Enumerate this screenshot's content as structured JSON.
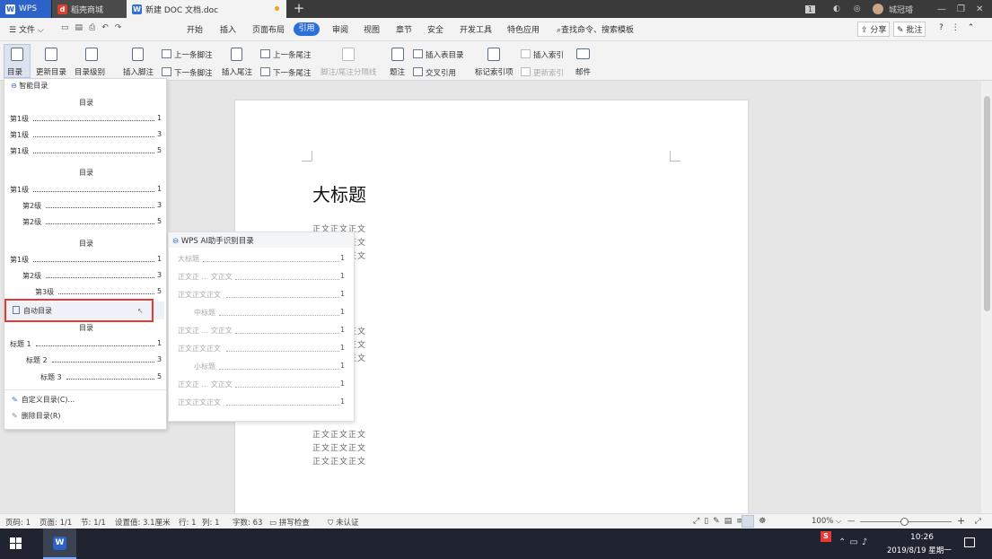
{
  "tabs": {
    "wps": "WPS",
    "daoke": "稻壳商城",
    "doc": "新建 DOC 文档.doc",
    "new_tab": "+"
  },
  "titlebar": {
    "badge": "1",
    "user": "城冠璿"
  },
  "menu": {
    "file": "文件",
    "items": [
      "开始",
      "插入",
      "页面布局",
      "引用",
      "审阅",
      "视图",
      "章节",
      "安全",
      "开发工具",
      "特色应用"
    ],
    "active": "引用",
    "search": "查找命令、搜索模板",
    "share": "分享",
    "annotate": "批注"
  },
  "ribbon": {
    "toc": "目录",
    "update_toc": "更新目录",
    "toc_level": "目录级别",
    "insert_footnote": "插入脚注",
    "prev_footnote": "上一条脚注",
    "next_footnote": "下一条脚注",
    "insert_endnote": "插入尾注",
    "prev_endnote": "上一条尾注",
    "next_endnote": "下一条尾注",
    "separator": "脚注/尾注分隔线",
    "caption": "题注",
    "insert_table_toc": "插入表目录",
    "cross_ref": "交叉引用",
    "mark_index": "标记索引项",
    "insert_index": "插入索引",
    "update_index": "更新索引",
    "mail": "邮件"
  },
  "dropdown": {
    "smart_toc": "智能目录",
    "toc_title": "目录",
    "style1": [
      {
        "label": "第1级",
        "page": "1"
      },
      {
        "label": "第1级",
        "page": "3"
      },
      {
        "label": "第1级",
        "page": "5"
      }
    ],
    "style2": [
      {
        "label": "第1级",
        "page": "1"
      },
      {
        "label": "第2级",
        "page": "3"
      },
      {
        "label": "第2级",
        "page": "5"
      }
    ],
    "style3": [
      {
        "label": "第1级",
        "page": "1"
      },
      {
        "label": "第2级",
        "page": "3"
      },
      {
        "label": "第3级",
        "page": "5"
      }
    ],
    "auto_toc": "自动目录",
    "auto_items": [
      {
        "label": "标题 1",
        "page": "1"
      },
      {
        "label": "标题 2",
        "page": "3"
      },
      {
        "label": "标题 3",
        "page": "5"
      }
    ],
    "custom_toc": "自定义目录(C)...",
    "delete_toc": "删除目录(R)"
  },
  "ai_submenu": {
    "title": "WPS AI助手识别目录",
    "items": [
      {
        "label": "大标题",
        "page": "1"
      },
      {
        "label": "正文正 ... 文正文",
        "page": "1"
      },
      {
        "label": "正文正文正文",
        "page": "1"
      },
      {
        "label": "中标题",
        "page": "1"
      },
      {
        "label": "正文正 ... 文正文",
        "page": "1"
      },
      {
        "label": "正文正文正文",
        "page": "1"
      },
      {
        "label": "小标题",
        "page": "1"
      },
      {
        "label": "正文正 ... 文正文",
        "page": "1"
      },
      {
        "label": "正文正文正文",
        "page": "1"
      }
    ]
  },
  "document": {
    "title": "大标题",
    "body_line": "正文正文正文"
  },
  "status": {
    "page_num": "页码: 1",
    "pages": "页面: 1/1",
    "section": "节: 1/1",
    "setting": "设置值: 3.1厘米",
    "row": "行: 1",
    "col": "列: 1",
    "words": "字数: 63",
    "spell": "拼写检查",
    "cert": "未认证",
    "zoom": "100%"
  },
  "taskbar": {
    "time": "10:26",
    "date": "2019/8/19 星期一"
  },
  "colors": {
    "accent": "#2d6fd8",
    "highlight": "#e53935"
  }
}
